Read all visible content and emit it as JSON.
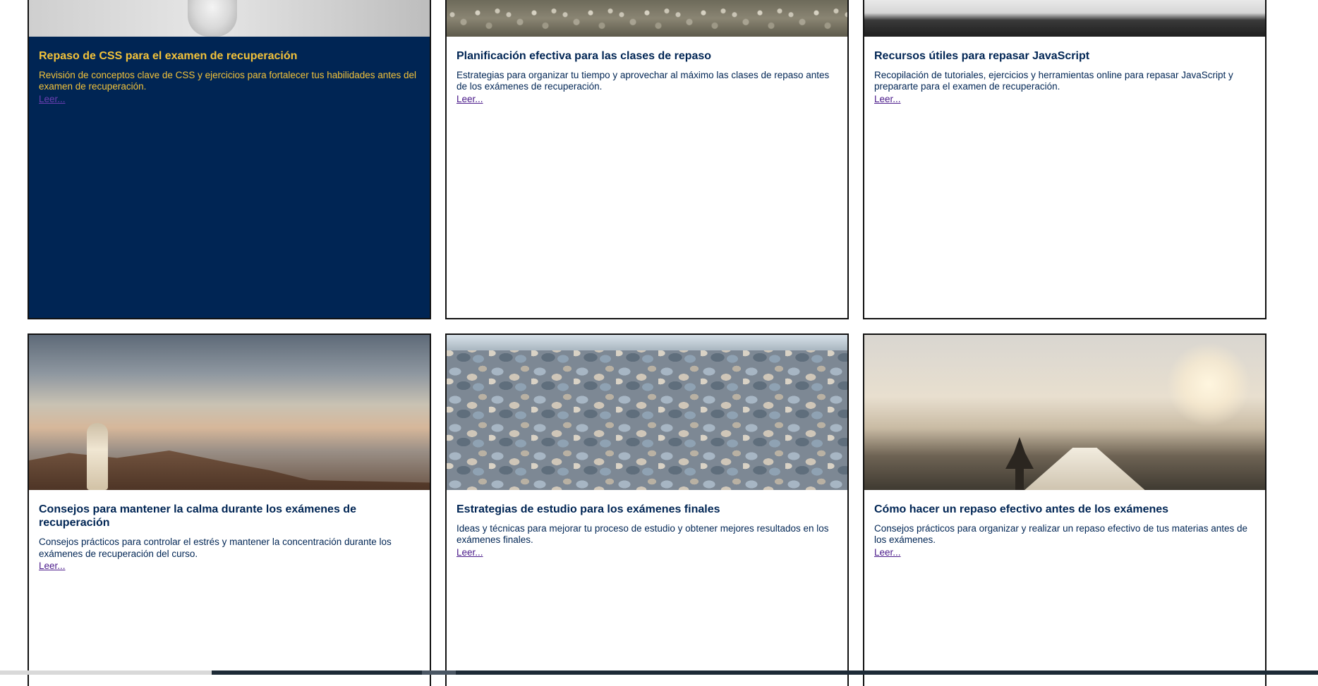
{
  "cards": [
    {
      "title": "Repaso de CSS para el examen de recuperación",
      "description": "Revisión de conceptos clave de CSS y ejercicios para fortalecer tus habilidades antes del examen de recuperación.",
      "link": "Leer...",
      "image": "statue-image",
      "active": true
    },
    {
      "title": "Planificación efectiva para las clases de repaso",
      "description": "Estrategias para organizar tu tiempo y aprovechar al máximo las clases de repaso antes de los exámenes de recuperación.",
      "link": "Leer...",
      "image": "rocks-image"
    },
    {
      "title": "Recursos útiles para repasar JavaScript",
      "description": "Recopilación de tutoriales, ejercicios y herramientas online para repasar JavaScript y prepararte para el examen de recuperación.",
      "link": "Leer...",
      "image": "forest-image"
    },
    {
      "title": "Consejos para mantener la calma durante los exámenes de recuperación",
      "description": "Consejos prácticos para controlar el estrés y mantener la concentración durante los exámenes de recuperación del curso.",
      "link": "Leer...",
      "image": "sunrise-monk-image"
    },
    {
      "title": "Estrategias de estudio para los exámenes finales",
      "description": "Ideas y técnicas para mejorar tu proceso de estudio y obtener mejores resultados en los exámenes finales.",
      "link": "Leer...",
      "image": "pebbles-image"
    },
    {
      "title": "Cómo hacer un repaso efectivo antes de los exámenes",
      "description": "Consejos prácticos para organizar y realizar un repaso efectivo de tus materias antes de los exámenes.",
      "link": "Leer...",
      "image": "valley-sunrise-image"
    }
  ],
  "colors": {
    "active_card_bg": "#002554",
    "active_text": "#f2c23a",
    "title_text": "#002554",
    "link_text": "#4a1a8a"
  }
}
